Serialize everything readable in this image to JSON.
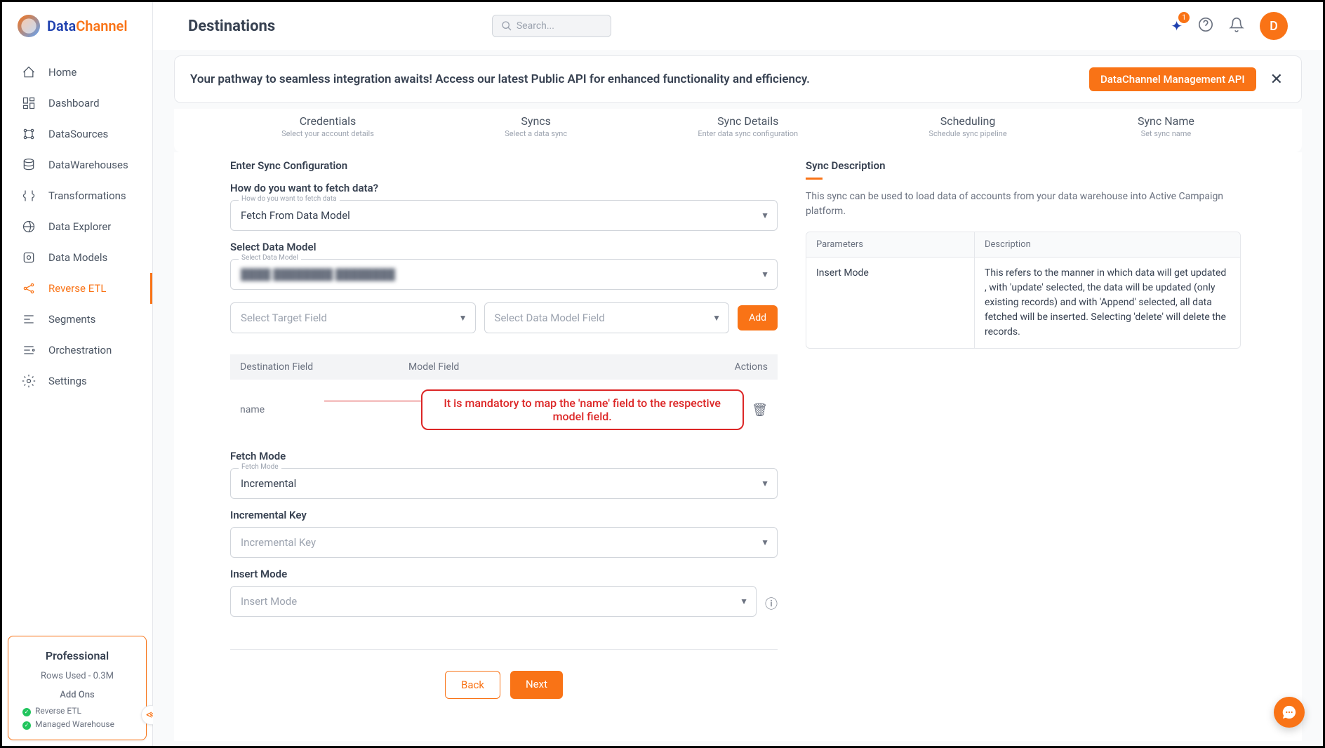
{
  "logo": {
    "part1": "Data",
    "part2": "Channel"
  },
  "page_title": "Destinations",
  "search": {
    "placeholder": "Search..."
  },
  "sparkle_badge": "1",
  "avatar_letter": "D",
  "nav": [
    {
      "label": "Home"
    },
    {
      "label": "Dashboard"
    },
    {
      "label": "DataSources"
    },
    {
      "label": "DataWarehouses"
    },
    {
      "label": "Transformations"
    },
    {
      "label": "Data Explorer"
    },
    {
      "label": "Data Models"
    },
    {
      "label": "Reverse ETL"
    },
    {
      "label": "Segments"
    },
    {
      "label": "Orchestration"
    },
    {
      "label": "Settings"
    }
  ],
  "sidebar_footer": {
    "plan": "Professional",
    "rows": "Rows Used - 0.3M",
    "addons_title": "Add Ons",
    "addons": [
      "Reverse ETL",
      "Managed Warehouse"
    ]
  },
  "banner": {
    "text": "Your pathway to seamless integration awaits! Access our latest Public API for enhanced functionality and efficiency.",
    "button": "DataChannel Management API"
  },
  "steps": [
    {
      "title": "Credentials",
      "sub": "Select your account details"
    },
    {
      "title": "Syncs",
      "sub": "Select a data sync"
    },
    {
      "title": "Sync Details",
      "sub": "Enter data sync configuration"
    },
    {
      "title": "Scheduling",
      "sub": "Schedule sync pipeline"
    },
    {
      "title": "Sync Name",
      "sub": "Set sync name"
    }
  ],
  "form": {
    "section_title": "Enter Sync Configuration",
    "fetch_question": "How do you want to fetch data?",
    "fetch_data_label": "How do you want to fetch data",
    "fetch_data_value": "Fetch From Data Model",
    "select_model_heading": "Select Data Model",
    "select_model_label": "Select Data Model",
    "select_model_value": "████ ████████ ████████",
    "target_field_placeholder": "Select Target Field",
    "model_field_placeholder": "Select Data Model Field",
    "add_button": "Add",
    "table_headers": {
      "h1": "Destination Field",
      "h2": "Model Field",
      "h3": "Actions"
    },
    "row_name": "name",
    "callout": "It is mandatory to map the 'name' field to the respective model field.",
    "fetch_mode_heading": "Fetch Mode",
    "fetch_mode_label": "Fetch Mode",
    "fetch_mode_value": "Incremental",
    "inc_key_heading": "Incremental Key",
    "inc_key_placeholder": "Incremental Key",
    "insert_mode_heading": "Insert Mode",
    "insert_mode_placeholder": "Insert Mode",
    "back": "Back",
    "next": "Next"
  },
  "desc": {
    "heading": "Sync Description",
    "text": "This sync can be used to load data of accounts from your data warehouse into Active Campaign platform.",
    "param_h1": "Parameters",
    "param_h2": "Description",
    "rows": [
      {
        "p": "Insert Mode",
        "d": "This refers to the manner in which data will get updated , with 'update' selected, the data will be updated (only existing records) and with 'Append' selected, all data fetched will be inserted. Selecting 'delete' will delete the records."
      }
    ]
  }
}
